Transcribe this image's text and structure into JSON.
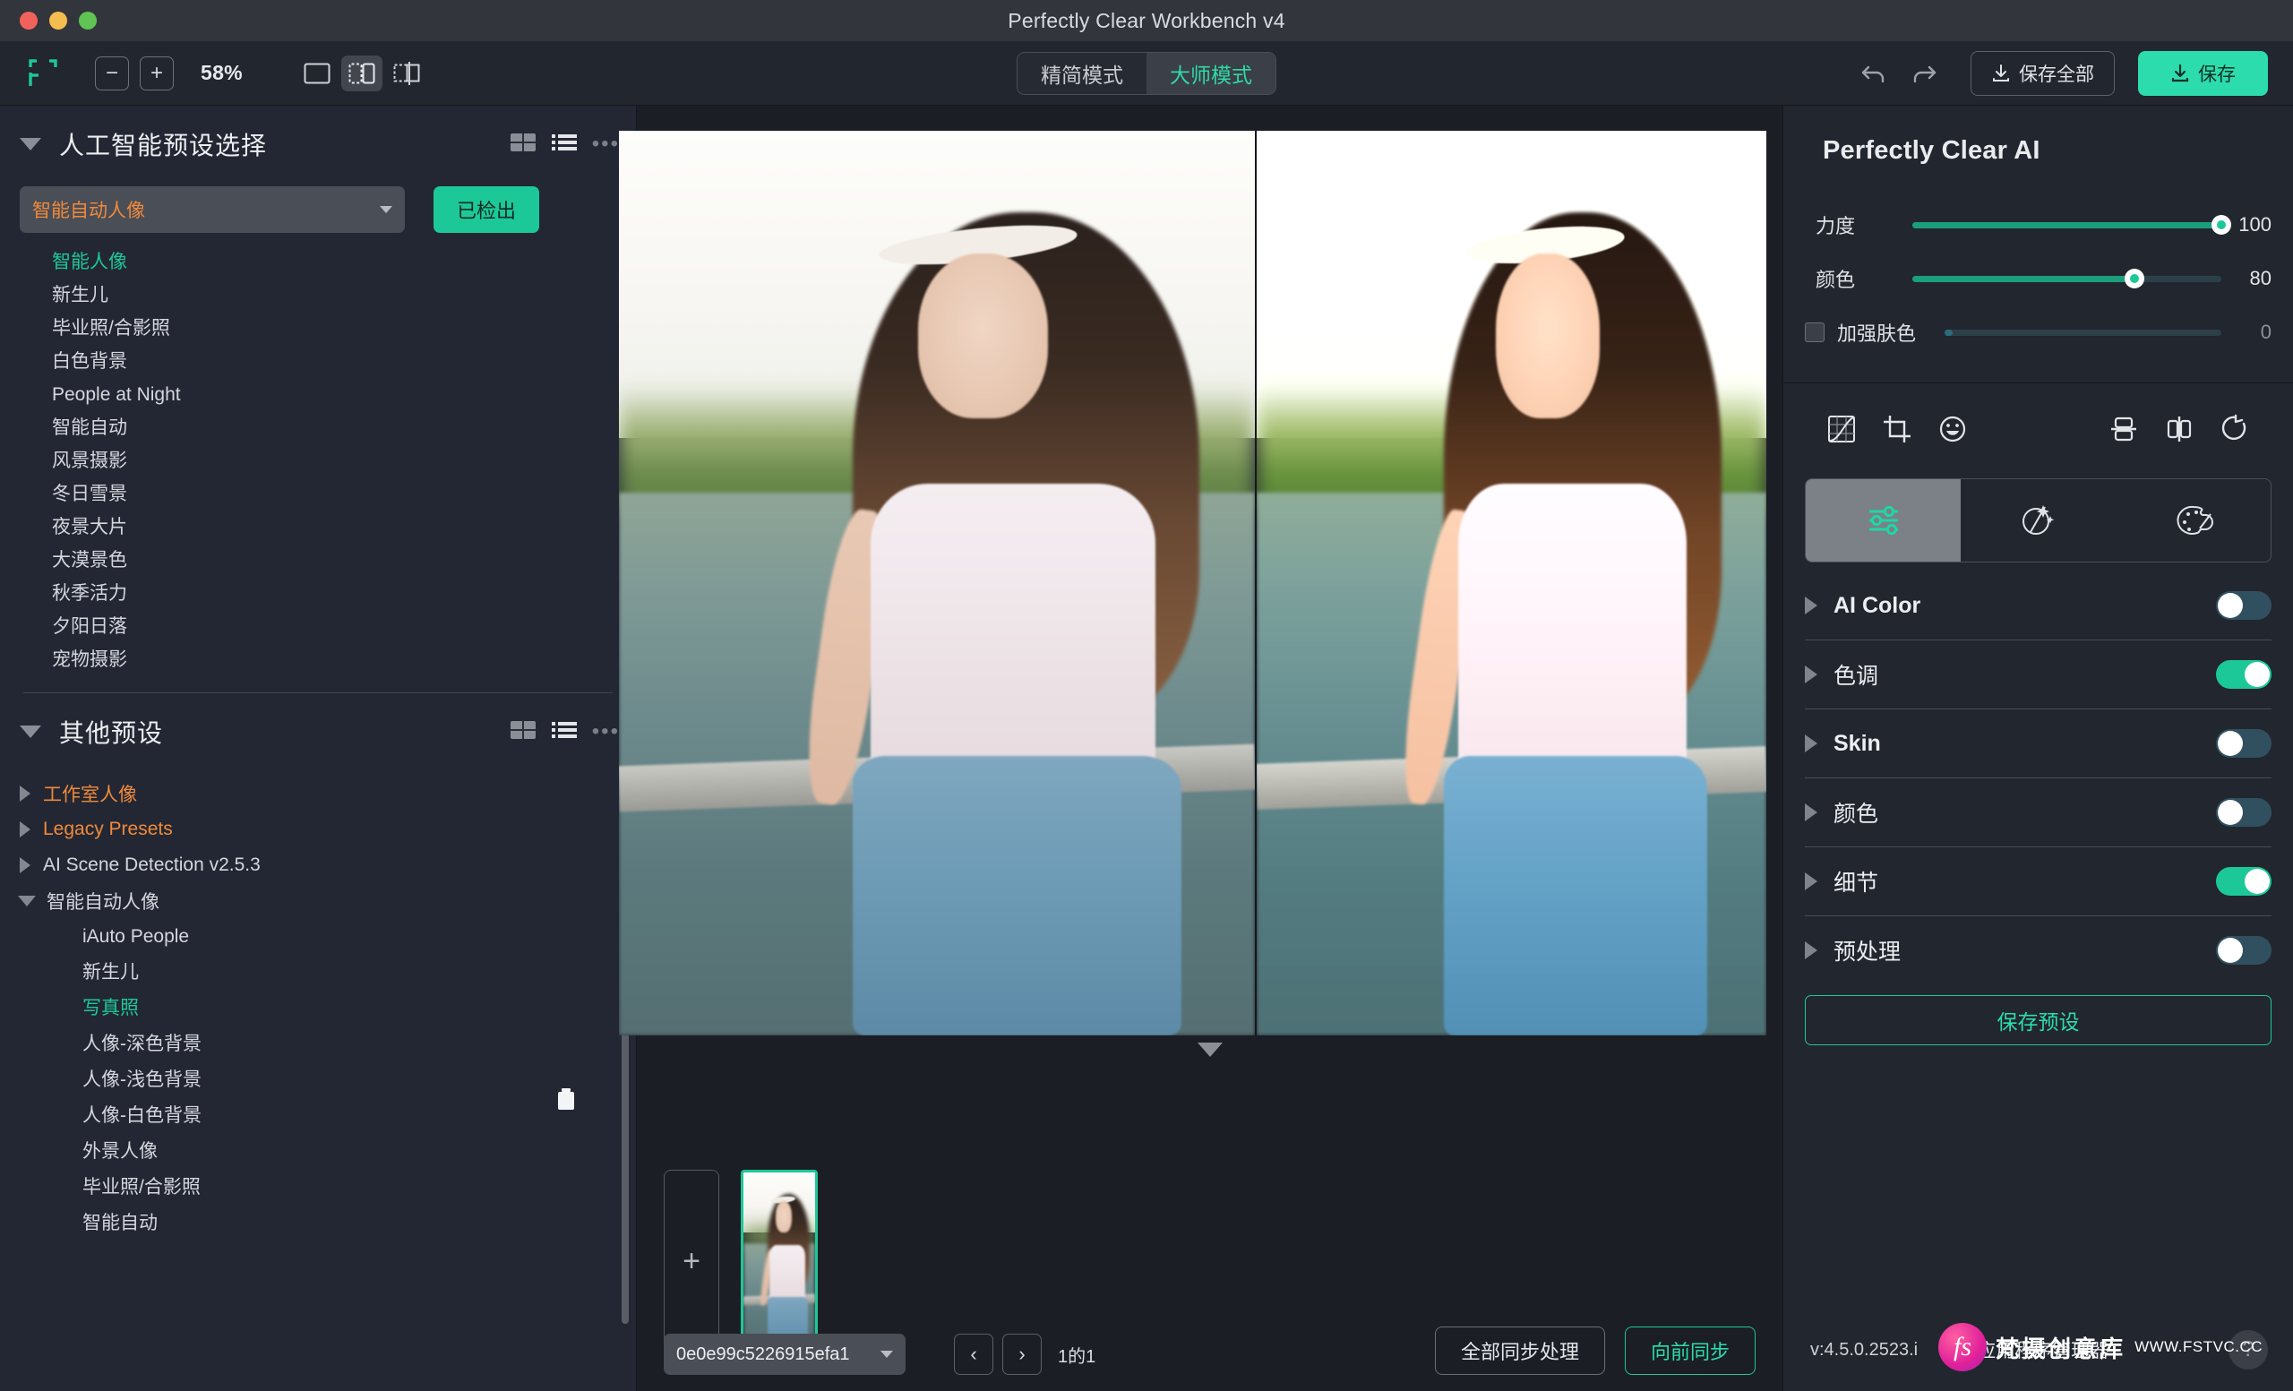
{
  "window": {
    "title": "Perfectly Clear Workbench v4"
  },
  "toolbar": {
    "zoom_out": "−",
    "zoom_in": "+",
    "zoom_level": "58%",
    "view_modes": [
      "single-view",
      "split-view",
      "crop-view"
    ],
    "mode_tabs": [
      {
        "label": "精简模式",
        "active": false
      },
      {
        "label": "大师模式",
        "active": true
      }
    ],
    "undo": "undo-icon",
    "redo": "redo-icon",
    "save_all_label": "保存全部",
    "save_label": "保存"
  },
  "left_panel": {
    "ai_section": {
      "title": "人工智能预设选择",
      "selected_preset": "智能自动人像",
      "detected_label": "已检出",
      "items": [
        {
          "label": "智能人像",
          "selected": true
        },
        {
          "label": "新生儿",
          "selected": false
        },
        {
          "label": "毕业照/合影照",
          "selected": false
        },
        {
          "label": "白色背景",
          "selected": false
        },
        {
          "label": "People at Night",
          "selected": false
        },
        {
          "label": "智能自动",
          "selected": false
        },
        {
          "label": "风景摄影",
          "selected": false
        },
        {
          "label": "冬日雪景",
          "selected": false
        },
        {
          "label": "夜景大片",
          "selected": false
        },
        {
          "label": "大漠景色",
          "selected": false
        },
        {
          "label": "秋季活力",
          "selected": false
        },
        {
          "label": "夕阳日落",
          "selected": false
        },
        {
          "label": "宠物摄影",
          "selected": false
        }
      ]
    },
    "other_section": {
      "title": "其他预设",
      "groups": [
        {
          "label": "工作室人像",
          "expanded": false,
          "color": "orange"
        },
        {
          "label": "Legacy Presets",
          "expanded": false,
          "color": "orange"
        },
        {
          "label": "AI Scene Detection v2.5.3",
          "expanded": false,
          "color": "normal"
        },
        {
          "label": "智能自动人像",
          "expanded": true,
          "color": "normal"
        }
      ],
      "children": [
        {
          "label": "iAuto People",
          "selected": false
        },
        {
          "label": "新生儿",
          "selected": false
        },
        {
          "label": "写真照",
          "selected": true
        },
        {
          "label": "人像-深色背景",
          "selected": false
        },
        {
          "label": "人像-浅色背景",
          "selected": false
        },
        {
          "label": "人像-白色背景",
          "selected": false
        },
        {
          "label": "外景人像",
          "selected": false
        },
        {
          "label": "毕业照/合影照",
          "selected": false
        },
        {
          "label": "智能自动",
          "selected": false
        }
      ]
    }
  },
  "filmstrip": {
    "add_label": "+",
    "file_name": "0e0e99c5226915efa1",
    "prev": "‹",
    "next": "›",
    "counter": "1的1",
    "sync_all_label": "全部同步处理",
    "sync_forward_label": "向前同步"
  },
  "right_panel": {
    "title": "Perfectly Clear AI",
    "sliders": [
      {
        "label": "力度",
        "value": "100",
        "percent": 100,
        "enabled": true,
        "checkbox": false
      },
      {
        "label": "颜色",
        "value": "80",
        "percent": 80,
        "enabled": true,
        "checkbox": false
      },
      {
        "label": "加强肤色",
        "value": "0",
        "percent": 3,
        "enabled": false,
        "checkbox": true
      }
    ],
    "tool_icons": [
      "curves-icon",
      "crop-icon",
      "face-icon",
      "flip-vertical-icon",
      "flip-horizontal-icon",
      "rotate-icon"
    ],
    "tabs": [
      {
        "name": "adjustments-icon",
        "active": true
      },
      {
        "name": "magic-wand-icon",
        "active": false
      },
      {
        "name": "palette-icon",
        "active": false
      }
    ],
    "accordion": [
      {
        "label": "AI Color",
        "on": false
      },
      {
        "label": "色调",
        "on": true
      },
      {
        "label": "Skin",
        "on": false
      },
      {
        "label": "颜色",
        "on": false
      },
      {
        "label": "细节",
        "on": true
      },
      {
        "label": "预处理",
        "on": false
      }
    ],
    "save_preset_label": "保存预设",
    "version": "v:4.5.0.2523.i",
    "app_manager_label": "打开应用程序管理器",
    "help": "?"
  },
  "watermark": {
    "mark": "fs",
    "name": "梵摄创意库",
    "url": "WWW.FSTVC.CC"
  },
  "colors": {
    "accent": "#1dc898",
    "orange": "#f08a3c",
    "panel": "#232733",
    "bg": "#1b1e25"
  }
}
